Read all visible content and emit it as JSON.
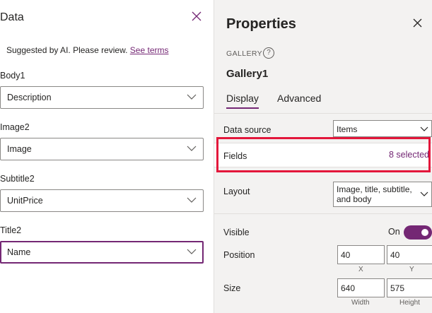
{
  "data_pane": {
    "title": "Data",
    "ai_note": "Suggested by AI. Please review.",
    "ai_link": "See terms",
    "fields": [
      {
        "label": "Body1",
        "value": "Description"
      },
      {
        "label": "Image2",
        "value": "Image"
      },
      {
        "label": "Subtitle2",
        "value": "UnitPrice"
      },
      {
        "label": "Title2",
        "value": "Name"
      }
    ]
  },
  "properties_pane": {
    "title": "Properties",
    "control_type": "GALLERY",
    "help_glyph": "?",
    "control_name": "Gallery1",
    "tabs": [
      "Display",
      "Advanced"
    ],
    "data_source": {
      "label": "Data source",
      "value": "Items"
    },
    "fields": {
      "label": "Fields",
      "value": "8 selected"
    },
    "layout": {
      "label": "Layout",
      "value_line1": "Image, title, subtitle,",
      "value_line2": "and body"
    },
    "visible": {
      "label": "Visible",
      "state": "On"
    },
    "position": {
      "label": "Position",
      "x": "40",
      "y": "40",
      "x_caption": "X",
      "y_caption": "Y"
    },
    "size": {
      "label": "Size",
      "width": "640",
      "height": "575",
      "width_caption": "Width",
      "height_caption": "Height"
    }
  },
  "colors": {
    "accent": "#742774",
    "highlight": "#e3173b",
    "pane_bg": "#f3f2f1"
  }
}
